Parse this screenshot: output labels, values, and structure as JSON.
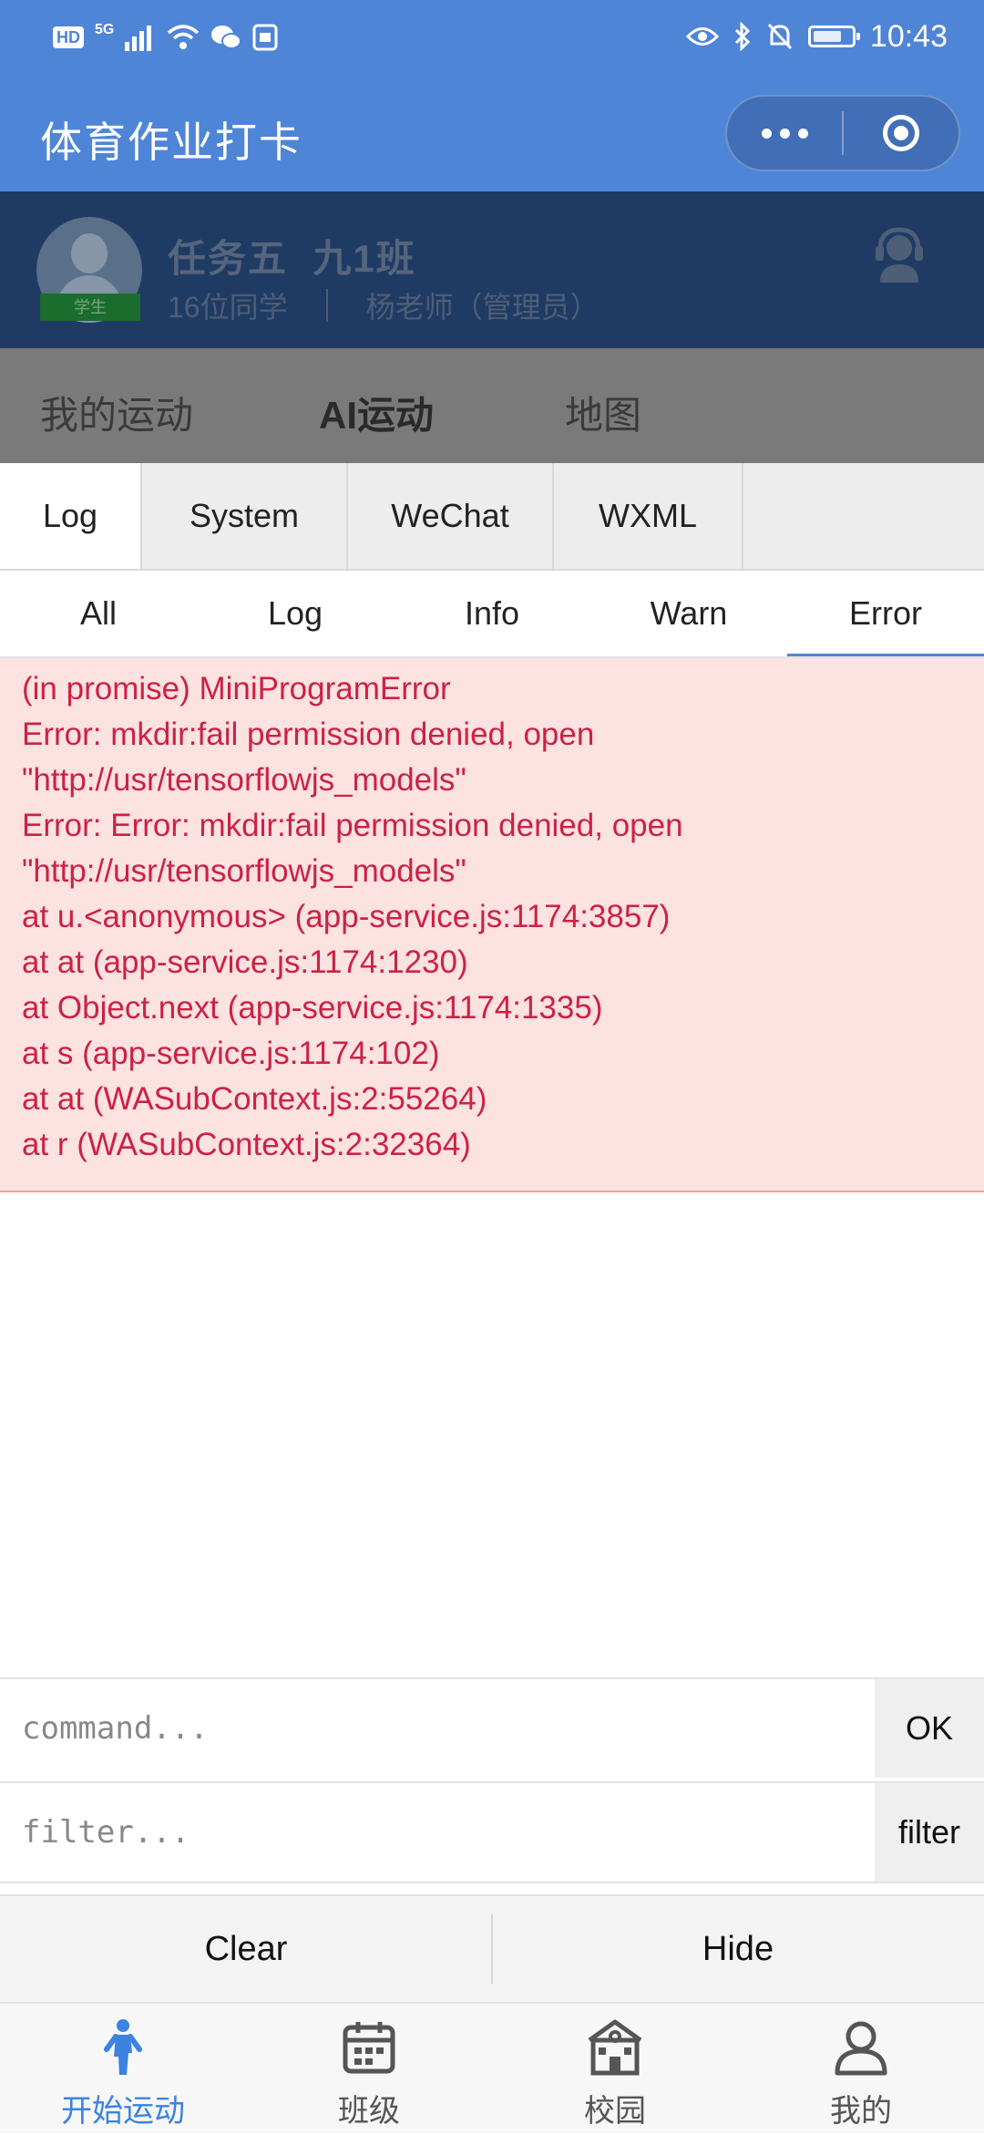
{
  "status_bar": {
    "time": "10:43",
    "network": "5G",
    "hd": "HD"
  },
  "title_bar": {
    "title": "体育作业打卡"
  },
  "class_header": {
    "task_name": "任务五  九1班",
    "student_count": "16位同学",
    "teacher": "杨老师（管理员）",
    "role_badge": "学生"
  },
  "page_tabs": [
    {
      "label": "我的运动",
      "active": false
    },
    {
      "label": "AI运动",
      "active": true
    },
    {
      "label": "地图",
      "active": false
    }
  ],
  "vconsole": {
    "tabs": [
      "Log",
      "System",
      "WeChat",
      "WXML"
    ],
    "active_tab": "Log",
    "level_tabs": [
      "All",
      "Log",
      "Info",
      "Warn",
      "Error"
    ],
    "active_level": "Error",
    "error_lines": [
      "(in promise) MiniProgramError",
      "Error: mkdir:fail permission denied, open",
      "\"http://usr/tensorflowjs_models\"",
      "Error: Error: mkdir:fail permission denied, open",
      "\"http://usr/tensorflowjs_models\"",
      "at u.<anonymous> (app-service.js:1174:3857)",
      "at at (app-service.js:1174:1230)",
      "at Object.next (app-service.js:1174:1335)",
      "at s (app-service.js:1174:102)",
      "at at (WASubContext.js:2:55264)",
      "at r (WASubContext.js:2:32364)"
    ],
    "command_placeholder": "command...",
    "command_button": "OK",
    "filter_placeholder": "filter...",
    "filter_button": "filter",
    "clear_button": "Clear",
    "hide_button": "Hide"
  },
  "bottom_nav": [
    {
      "label": "开始运动",
      "icon": "runner-icon",
      "active": true
    },
    {
      "label": "班级",
      "icon": "calendar-icon",
      "active": false
    },
    {
      "label": "校园",
      "icon": "school-icon",
      "active": false
    },
    {
      "label": "我的",
      "icon": "user-icon",
      "active": false
    }
  ],
  "colors": {
    "primary": "#4f85d7",
    "error_text": "#cc2244",
    "error_bg": "#fde2e2",
    "nav_active": "#3d82e0"
  }
}
